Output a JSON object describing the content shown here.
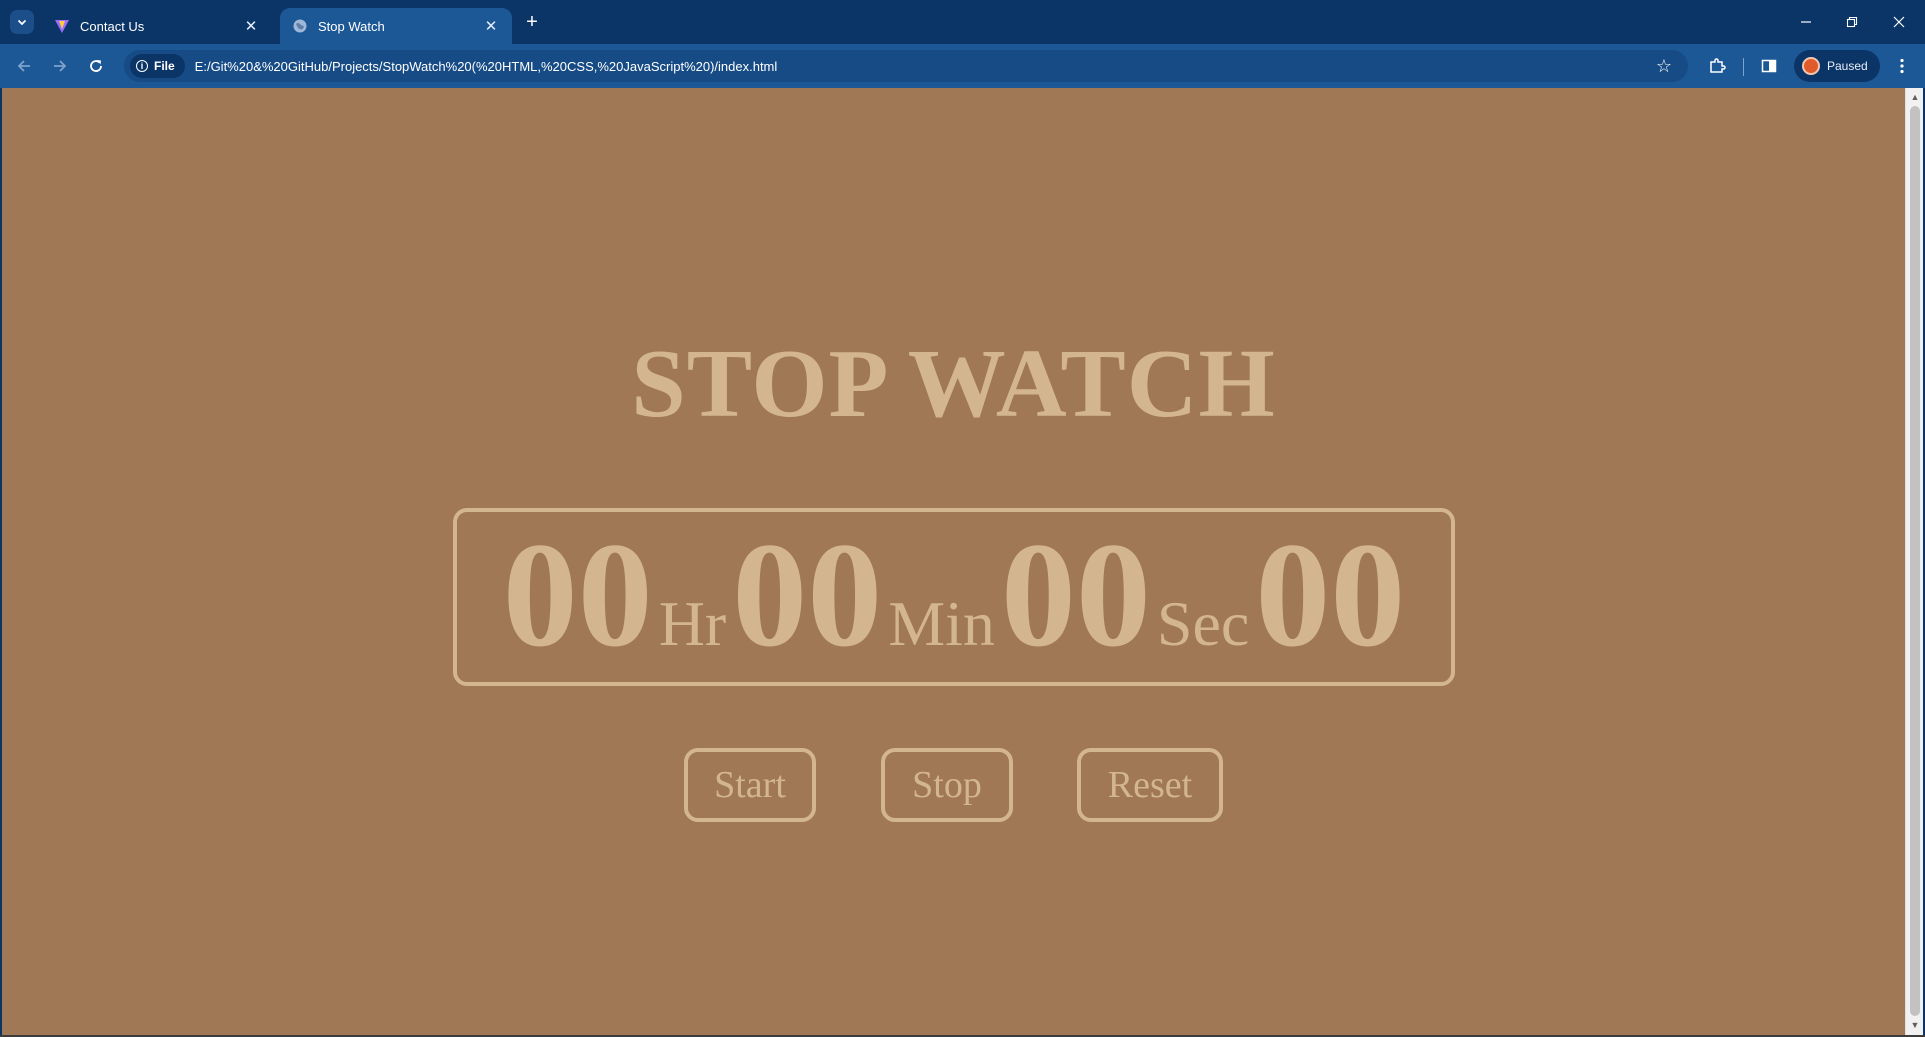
{
  "browser": {
    "tabs": [
      {
        "title": "Contact Us",
        "active": false
      },
      {
        "title": "Stop Watch",
        "active": true
      }
    ],
    "omnibox": {
      "scheme_chip": "File",
      "url": "E:/Git%20&%20GitHub/Projects/StopWatch%20(%20HTML,%20CSS,%20JavaScript%20)/index.html"
    },
    "profile_label": "Paused",
    "icons": {
      "tab_search": "chevron-down-icon",
      "new_tab": "plus-icon",
      "back": "arrow-left-icon",
      "forward": "arrow-right-icon",
      "reload": "reload-icon",
      "bookmark": "star-icon",
      "extensions": "puzzle-icon",
      "side_panel": "side-panel-icon",
      "menu": "kebab-menu-icon"
    }
  },
  "page": {
    "title": "STOP WATCH",
    "display": {
      "hours": "00",
      "hours_unit": "Hr",
      "minutes": "00",
      "minutes_unit": "Min",
      "seconds": "00",
      "seconds_unit": "Sec",
      "milliseconds": "00"
    },
    "buttons": {
      "start": "Start",
      "stop": "Stop",
      "reset": "Reset"
    },
    "colors": {
      "background": "#a07855",
      "accent": "#d3b690",
      "browser_frame": "#0b3566",
      "toolbar": "#1c5796"
    }
  }
}
